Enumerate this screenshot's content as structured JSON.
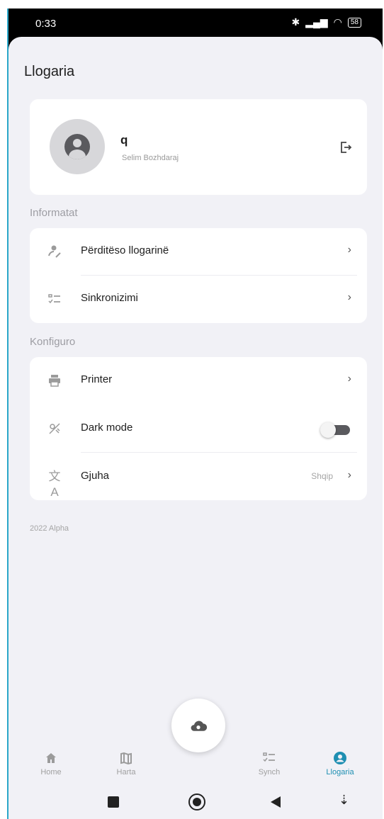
{
  "status": {
    "time": "0:33",
    "battery": "58"
  },
  "page_title": "Llogaria",
  "profile": {
    "name": "q",
    "subtitle": "Selim Bozhdaraj"
  },
  "sections": {
    "info": {
      "label": "Informatat",
      "items": [
        {
          "label": "Përditëso llogarinë",
          "icon": "user-edit-icon"
        },
        {
          "label": "Sinkronizimi",
          "icon": "sync-list-icon"
        }
      ]
    },
    "config": {
      "label": "Konfiguro",
      "items": [
        {
          "label": "Printer",
          "icon": "printer-icon"
        },
        {
          "label": "Dark mode",
          "icon": "dark-mode-icon",
          "toggle": false
        },
        {
          "label": "Gjuha",
          "icon": "translate-icon",
          "value": "Shqip"
        }
      ]
    }
  },
  "version": "2022 Alpha",
  "bottom_nav": [
    {
      "label": "Home",
      "icon": "home-icon"
    },
    {
      "label": "Harta",
      "icon": "map-icon"
    },
    {
      "label": "Synch",
      "icon": "sync-list-icon"
    },
    {
      "label": "Llogaria",
      "icon": "account-icon",
      "active": true
    }
  ],
  "colors": {
    "accent": "#1e8fb2",
    "background": "#f1f1f6"
  }
}
